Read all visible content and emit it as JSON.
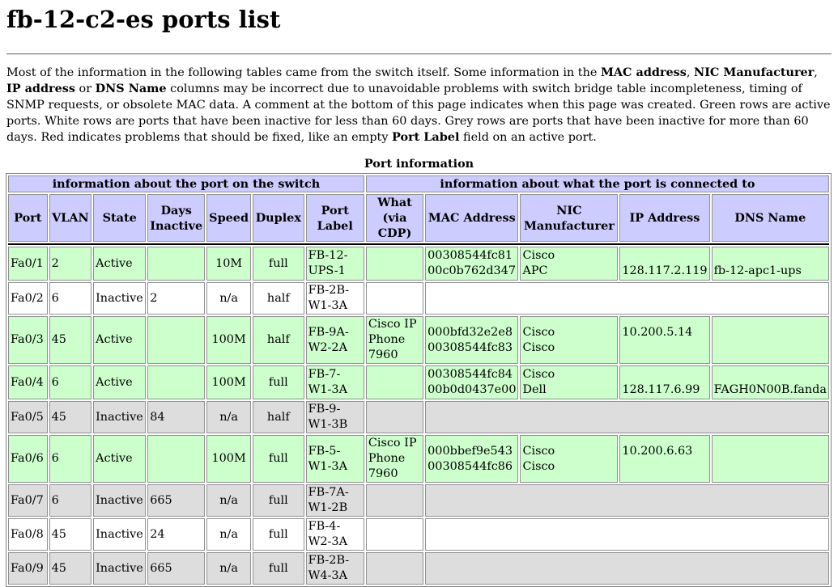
{
  "title": "fb-12-c2-es ports list",
  "intro": {
    "t1": "Most of the information in the following tables came from the switch itself. Some information in the ",
    "b1": "MAC address",
    "t2": ", ",
    "b2": "NIC Manufacturer",
    "t3": ", ",
    "b3": "IP address",
    "t4": " or ",
    "b4": "DNS Name",
    "t5": " columns may be incorrect due to unavoidable problems with switch bridge table incompleteness, timing of SNMP requests, or obsolete MAC data. A comment at the bottom of this page indicates when this page was created. Green rows are active ports. White rows are ports that have been inactive for less than 60 days. Grey rows are ports that have been inactive for more than 60 days. Red indicates problems that should be fixed, like an empty ",
    "b5": "Port Label",
    "t6": " field on an active port."
  },
  "table": {
    "caption": "Port information",
    "group_switch": "information about the port on the switch",
    "group_connected": "information about what the port is connected to",
    "columns": [
      {
        "label": "Port"
      },
      {
        "label": "VLAN"
      },
      {
        "label": "State"
      },
      {
        "label": "Days Inactive"
      },
      {
        "label": "Speed"
      },
      {
        "label": "Duplex"
      },
      {
        "label": "Port Label"
      },
      {
        "label": "What (via CDP)"
      },
      {
        "label": "MAC Address"
      },
      {
        "label": "NIC Manufacturer"
      },
      {
        "label": "IP Address"
      },
      {
        "label": "DNS Name"
      }
    ],
    "rows": [
      {
        "status": "active",
        "port": "Fa0/1",
        "vlan": "2",
        "state": "Active",
        "days": "",
        "speed": "10M",
        "duplex": "full",
        "label": "FB-12-UPS-1",
        "what": [
          "",
          ""
        ],
        "mac": [
          "00308544fc81",
          "00c0b762d347"
        ],
        "nic": [
          "Cisco",
          "APC"
        ],
        "ip": [
          "",
          "128.117.2.119"
        ],
        "dns": [
          "",
          "fb-12-apc1-ups"
        ]
      },
      {
        "status": "recent",
        "port": "Fa0/2",
        "vlan": "6",
        "state": "Inactive",
        "days": "2",
        "speed": "n/a",
        "duplex": "half",
        "label": "FB-2B-W1-3A"
      },
      {
        "status": "active",
        "port": "Fa0/3",
        "vlan": "45",
        "state": "Active",
        "days": "",
        "speed": "100M",
        "duplex": "half",
        "label": "FB-9A-W2-2A",
        "what": [
          "Cisco IP Phone",
          "7960"
        ],
        "mac": [
          "000bfd32e2e8",
          "00308544fc83"
        ],
        "nic": [
          "Cisco",
          "Cisco"
        ],
        "ip": [
          "10.200.5.14",
          ""
        ],
        "dns": [
          "",
          ""
        ]
      },
      {
        "status": "active",
        "port": "Fa0/4",
        "vlan": "6",
        "state": "Active",
        "days": "",
        "speed": "100M",
        "duplex": "full",
        "label": "FB-7-W1-3A",
        "what": [
          "",
          ""
        ],
        "mac": [
          "00308544fc84",
          "00b0d0437e00"
        ],
        "nic": [
          "Cisco",
          "Dell"
        ],
        "ip": [
          "",
          "128.117.6.99"
        ],
        "dns": [
          "",
          "FAGH0N00B.fanda"
        ]
      },
      {
        "status": "old",
        "port": "Fa0/5",
        "vlan": "45",
        "state": "Inactive",
        "days": "84",
        "speed": "n/a",
        "duplex": "half",
        "label": "FB-9-W1-3B"
      },
      {
        "status": "active",
        "port": "Fa0/6",
        "vlan": "6",
        "state": "Active",
        "days": "",
        "speed": "100M",
        "duplex": "full",
        "label": "FB-5-W1-3A",
        "what": [
          "Cisco IP Phone",
          "7960"
        ],
        "mac": [
          "000bbef9e543",
          "00308544fc86"
        ],
        "nic": [
          "Cisco",
          "Cisco"
        ],
        "ip": [
          "10.200.6.63",
          ""
        ],
        "dns": [
          "",
          ""
        ]
      },
      {
        "status": "old",
        "port": "Fa0/7",
        "vlan": "6",
        "state": "Inactive",
        "days": "665",
        "speed": "n/a",
        "duplex": "full",
        "label": "FB-7A-W1-2B"
      },
      {
        "status": "recent",
        "port": "Fa0/8",
        "vlan": "45",
        "state": "Inactive",
        "days": "24",
        "speed": "n/a",
        "duplex": "full",
        "label": "FB-4-W2-3A"
      },
      {
        "status": "old",
        "port": "Fa0/9",
        "vlan": "45",
        "state": "Inactive",
        "days": "665",
        "speed": "n/a",
        "duplex": "full",
        "label": "FB-2B-W4-3A"
      }
    ]
  }
}
